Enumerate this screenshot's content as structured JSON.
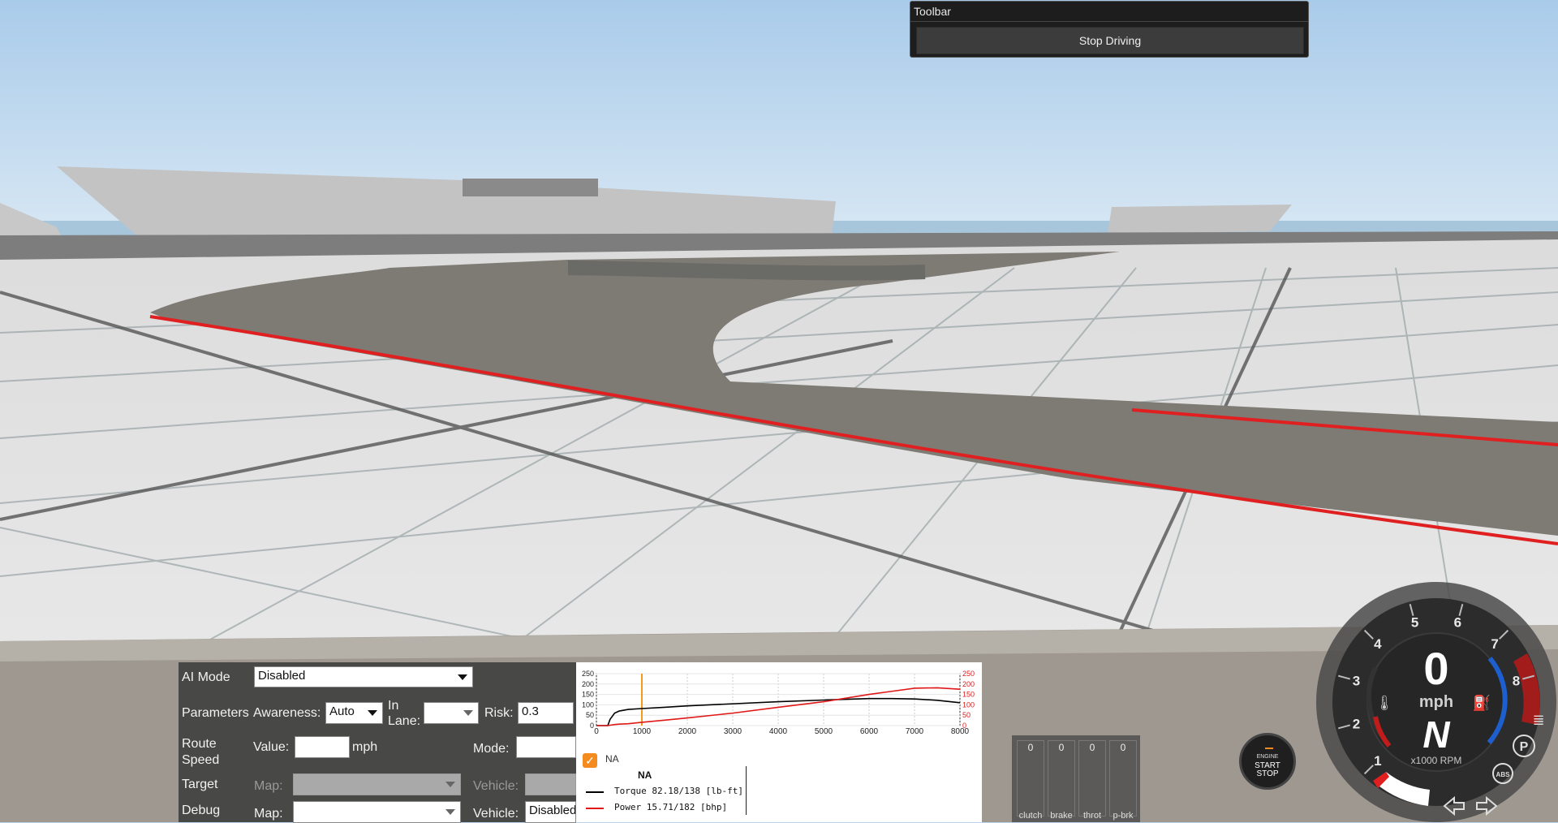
{
  "toolbar": {
    "title": "Toolbar",
    "stop_driving": "Stop Driving"
  },
  "ai_panel": {
    "ai_mode_label": "AI Mode",
    "ai_mode_value": "Disabled",
    "parameters_label": "Parameters",
    "awareness_label": "Awareness:",
    "awareness_value": "Auto",
    "in_lane_label_1": "In",
    "in_lane_label_2": "Lane:",
    "in_lane_value": "",
    "risk_label": "Risk:",
    "risk_value": "0.3",
    "route_speed_label_1": "Route",
    "route_speed_label_2": "Speed",
    "value_label": "Value:",
    "value_value": "",
    "unit_mph": "mph",
    "mode_label": "Mode:",
    "mode_value": "",
    "target_label": "Target",
    "target_map_label": "Map:",
    "target_vehicle_label": "Vehicle:",
    "debug_label": "Debug",
    "debug_map_label": "Map:",
    "debug_vehicle_label": "Vehicle:",
    "debug_vehicle_value": "Disabled"
  },
  "graph_panel": {
    "checkbox_label": "NA",
    "checkbox_checked": true,
    "legend_title": "NA",
    "torque_label": "Torque 82.18/138 [lb-ft]",
    "power_label": "Power  15.71/182 [bhp]"
  },
  "chart_data": {
    "type": "line",
    "x": [
      0,
      250,
      300,
      400,
      500,
      700,
      1000,
      1500,
      2000,
      3000,
      4000,
      5000,
      6000,
      6500,
      7000,
      7500,
      8000
    ],
    "xlim": [
      0,
      8000
    ],
    "x_ticks": [
      "0",
      "1000",
      "2000",
      "3000",
      "4000",
      "5000",
      "6000",
      "7000",
      "8000"
    ],
    "y_left_ticks": [
      "0",
      "50",
      "100",
      "150",
      "200",
      "250"
    ],
    "y_right_ticks": [
      "0",
      "50",
      "100",
      "150",
      "200",
      "250"
    ],
    "ylim": [
      0,
      250
    ],
    "marker_x": 1000,
    "series": [
      {
        "name": "Torque",
        "color": "#000000",
        "values": [
          0,
          0,
          30,
          60,
          70,
          78,
          82,
          88,
          95,
          105,
          115,
          123,
          130,
          130,
          128,
          122,
          110
        ]
      },
      {
        "name": "Power",
        "color": "#e01818",
        "values": [
          0,
          0,
          2,
          5,
          7,
          9,
          16,
          26,
          37,
          60,
          88,
          115,
          150,
          165,
          180,
          182,
          175
        ]
      }
    ]
  },
  "pedals": {
    "items": [
      {
        "label": "clutch",
        "value": "0"
      },
      {
        "label": "brake",
        "value": "0"
      },
      {
        "label": "throt",
        "value": "0"
      },
      {
        "label": "p-brk",
        "value": "0"
      }
    ]
  },
  "engine_button": {
    "line1": "ENGINE",
    "line2": "START",
    "line3": "STOP"
  },
  "gauge": {
    "speed": "0",
    "speed_unit": "mph",
    "gear": "N",
    "rpm_label": "x1000 RPM",
    "rpm_ticks": [
      "1",
      "2",
      "3",
      "4",
      "5",
      "6",
      "7",
      "8"
    ],
    "parking_badge": "P",
    "abs_badge": "ABS"
  }
}
